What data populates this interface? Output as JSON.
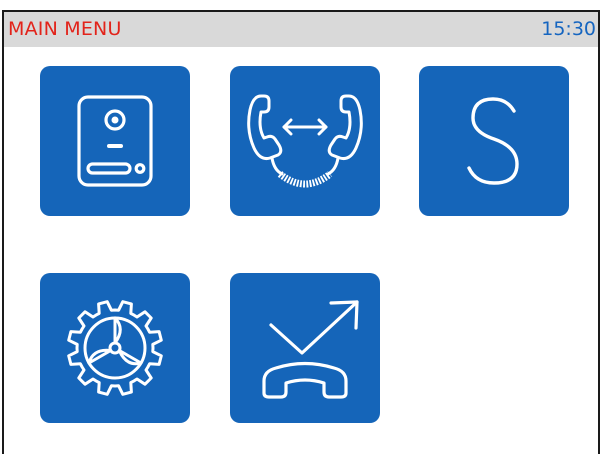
{
  "header": {
    "title": "MAIN MENU",
    "time": "15:30"
  },
  "colors": {
    "title": "#e2231a",
    "clock": "#1565c0",
    "header_bg": "#d9d9d9",
    "tile_bg": "#1565b9",
    "icon_stroke": "#ffffff"
  },
  "tiles": [
    {
      "icon": "door-panel-icon"
    },
    {
      "icon": "intercom-call-icon"
    },
    {
      "icon": "letter-s-icon",
      "label": "S"
    },
    {
      "icon": "gear-settings-icon"
    },
    {
      "icon": "call-forward-icon"
    }
  ]
}
